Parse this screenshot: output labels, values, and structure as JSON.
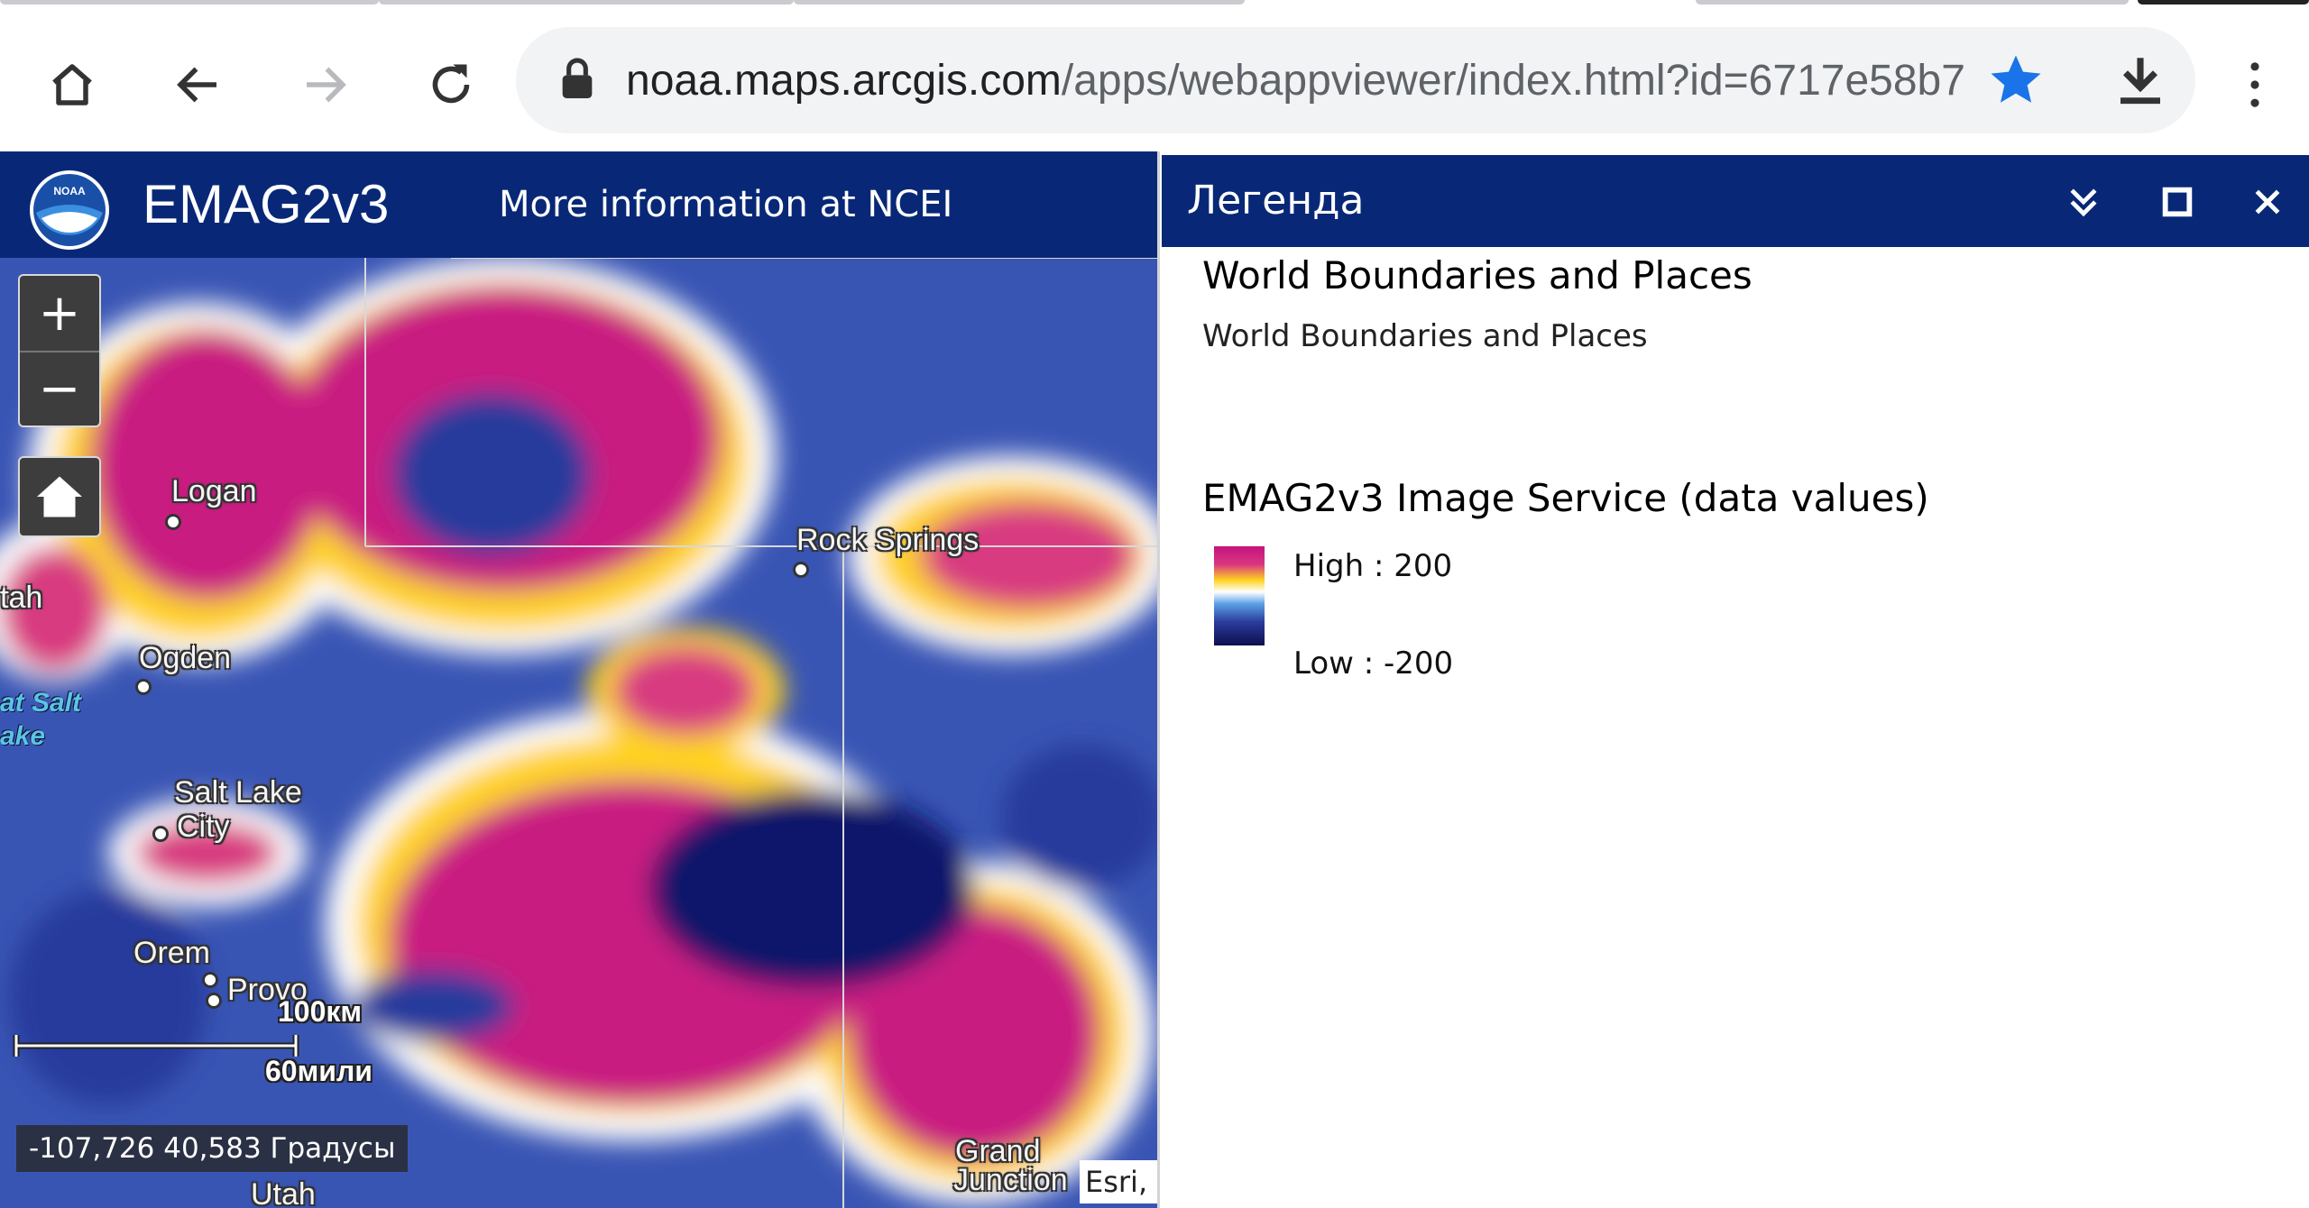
{
  "browser": {
    "url_host": "noaa.maps.arcgis.com",
    "url_path": "/apps/webappviewer/index.html?id=6717e58b7",
    "icons": [
      "home-icon",
      "back-arrow-icon",
      "forward-arrow-icon",
      "reload-icon",
      "lock-icon",
      "star-icon",
      "download-icon",
      "more-vert-icon"
    ],
    "colors": {
      "star": "#1a73e8",
      "omnibox": "#f1f3f4"
    }
  },
  "app": {
    "title": "EMAG2v3",
    "link": "More information at NCEI",
    "header_color": "#082877"
  },
  "map": {
    "controls": {
      "zoom_in": "+",
      "zoom_out": "−"
    },
    "places": [
      "Logan",
      "Rock Springs",
      "Ogden",
      "Salt Lake",
      "City",
      "Orem",
      "Provo",
      "Grand",
      "Junction",
      "Utah",
      "tah"
    ],
    "water_labels": [
      "at Salt",
      "ake"
    ],
    "scale": {
      "km": "100км",
      "mi": "60мили"
    },
    "coordinates": "-107,726 40,583 Градусы",
    "attribution": "Esri,"
  },
  "legend": {
    "title": "Легенда",
    "layers": [
      {
        "name": "World Boundaries and Places",
        "sub": "World Boundaries and Places"
      },
      {
        "name": "EMAG2v3 Image Service (data values)",
        "high": "High : 200",
        "low": "Low : -200"
      }
    ]
  }
}
